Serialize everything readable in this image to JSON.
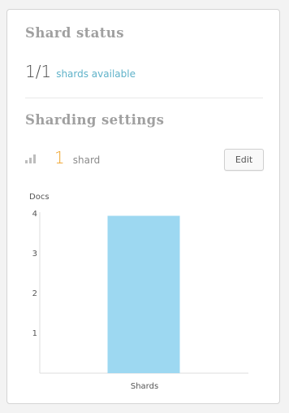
{
  "shard_status": {
    "title": "Shard status",
    "count": "1/1",
    "link_label": "shards available"
  },
  "sharding_settings": {
    "title": "Sharding settings",
    "icon": "bars-icon",
    "shard_count": "1",
    "shard_unit": "shard",
    "edit_label": "Edit"
  },
  "chart_data": {
    "type": "bar",
    "categories": [
      "Shards"
    ],
    "values": [
      3.95
    ],
    "xlabel": "Shards",
    "ylabel": "Docs",
    "ylim": [
      0,
      4
    ],
    "yticks": [
      "1",
      "2",
      "3",
      "4"
    ],
    "bar_color": "#9dd8f1"
  },
  "colors": {
    "accent_orange": "#f0a32a",
    "link_blue": "#5fb2c9"
  }
}
